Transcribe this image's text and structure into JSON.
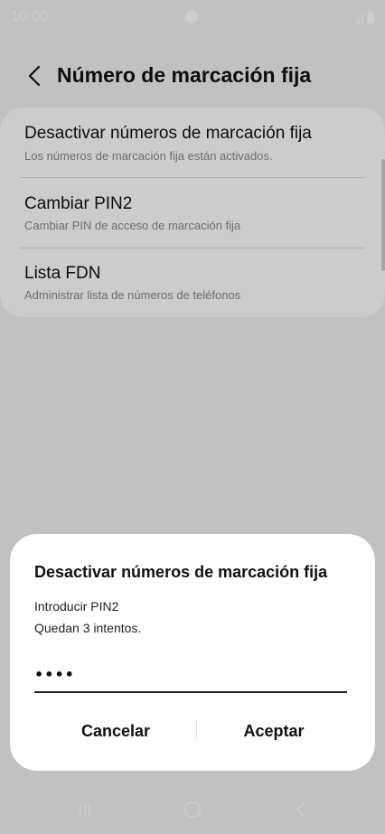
{
  "status_bar": {
    "time": "10:00"
  },
  "header": {
    "title": "Número de marcación fija",
    "back_icon": "chevron-left-icon"
  },
  "settings": {
    "items": [
      {
        "title": "Desactivar números de marcación fija",
        "subtitle": "Los números de marcación fija están activados."
      },
      {
        "title": "Cambiar PIN2",
        "subtitle": "Cambiar PIN de acceso de marcación fija"
      },
      {
        "title": "Lista FDN",
        "subtitle": "Administrar lista de números de teléfonos"
      }
    ]
  },
  "dialog": {
    "title": "Desactivar números de marcación fija",
    "message_line1": "Introducir PIN2",
    "message_line2": "Quedan 3 intentos.",
    "pin_value": "••••",
    "cancel_label": "Cancelar",
    "accept_label": "Aceptar"
  },
  "nav_bar": {
    "icons": [
      "recents-icon",
      "home-icon",
      "back-icon"
    ]
  },
  "colors": {
    "dim_overlay": "#000000",
    "dialog_background": "#ffffff",
    "card_background": "#ffffff",
    "subtitle_text": "#8a8a8a"
  }
}
